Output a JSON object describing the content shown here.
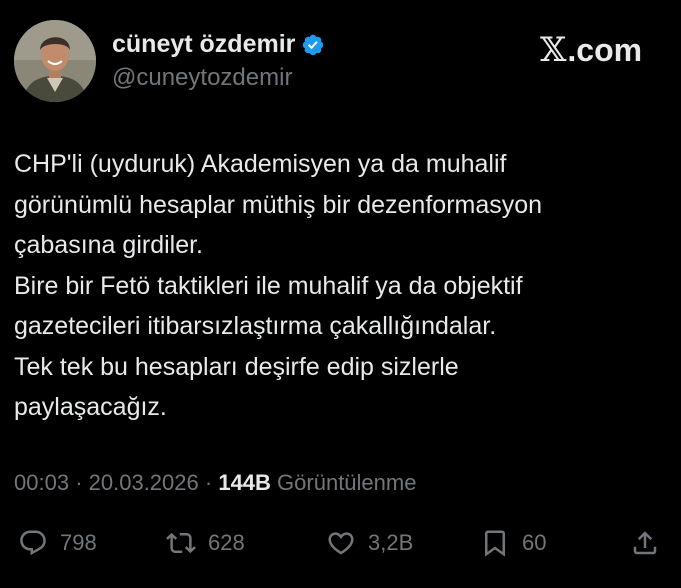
{
  "author": {
    "display_name": "cüneyt özdemir",
    "handle": "@cuneytozdemir",
    "verified": true
  },
  "site": {
    "logo_mark": "𝕏",
    "logo_suffix": ".com"
  },
  "tweet": {
    "lines": [
      "CHP'li (uyduruk) Akademisyen ya da muhalif",
      "görünümlü hesaplar müthiş bir dezenformasyon",
      "çabasına girdiler.",
      "Bire bir Fetö taktikleri ile muhalif ya da objektif",
      "gazetecileri itibarsızlaştırma çakallığındalar.",
      "Tek tek bu hesapları deşirfe edip sizlerle",
      "paylaşacağız."
    ]
  },
  "meta": {
    "time": "00:03",
    "separator": "·",
    "date": "20.03.2026",
    "views_count": "144B",
    "views_label": "Görüntülenme"
  },
  "actions": {
    "replies": "798",
    "reposts": "628",
    "likes": "3,2B",
    "bookmarks": "60"
  },
  "colors": {
    "background": "#000000",
    "primary_text": "#e7e9ea",
    "secondary_text": "#71767b",
    "verified": "#1d9bf0"
  },
  "icons": [
    "verified-badge-icon",
    "reply-icon",
    "repost-icon",
    "like-icon",
    "bookmark-icon",
    "share-icon"
  ]
}
